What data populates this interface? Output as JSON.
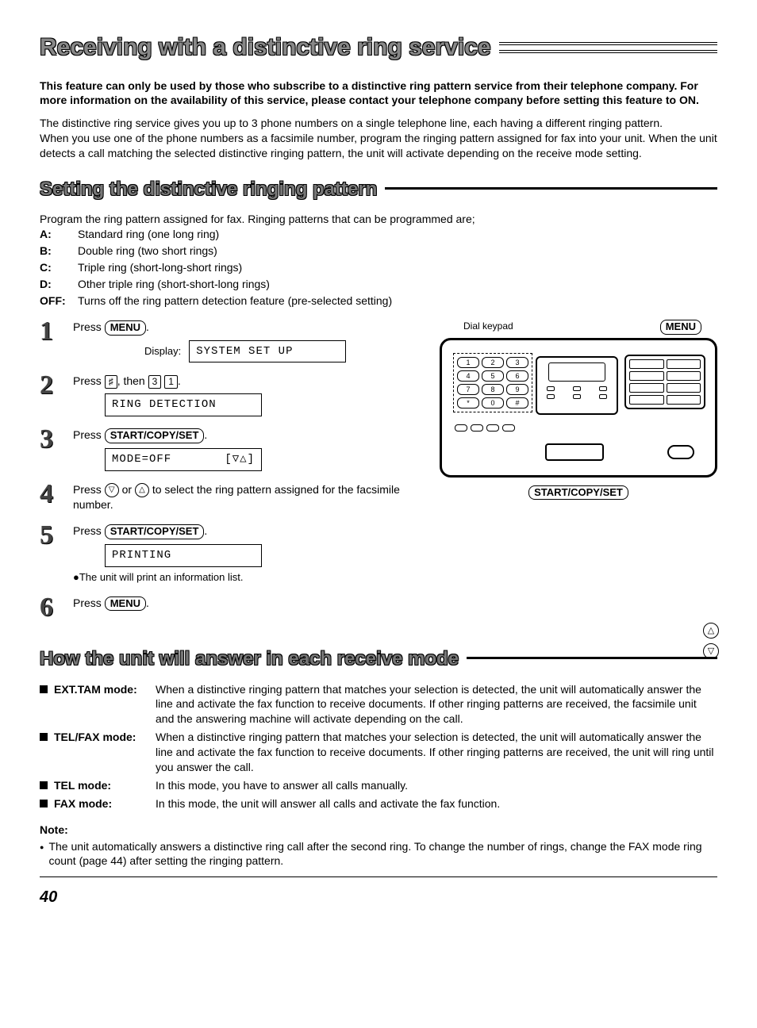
{
  "title": "Receiving with a distinctive ring service",
  "intro_bold": "This feature can only be used by those who subscribe to a distinctive ring pattern service from their telephone company. For more information on the availability of this service, please contact your telephone company before setting this feature to ON.",
  "intro_reg": "The distinctive ring service gives you up to 3 phone numbers on a single telephone line, each having a different ringing pattern.\nWhen you use one of the phone numbers as a facsimile number, program the ringing pattern assigned for fax into your unit. When the unit detects a call matching the selected distinctive ringing pattern, the unit will activate depending on the receive mode setting.",
  "section1": "Setting the distinctive ringing pattern",
  "patterns_intro": "Program the ring pattern assigned for fax. Ringing patterns that can be programmed are;",
  "patterns": [
    {
      "k": "A:",
      "v": "Standard ring (one long ring)"
    },
    {
      "k": "B:",
      "v": "Double ring (two short rings)"
    },
    {
      "k": "C:",
      "v": "Triple ring (short-long-short rings)"
    },
    {
      "k": "D:",
      "v": "Other triple ring (short-short-long rings)"
    },
    {
      "k": "OFF:",
      "v": "Turns off the ring pattern detection feature (pre-selected setting)"
    }
  ],
  "steps": {
    "s1_pre": "Press ",
    "s1_btn": "MENU",
    "s1_post": ".",
    "disp_label": "Display:",
    "lcd1": "SYSTEM SET UP",
    "s2_pre": "Press ",
    "s2_k1": "♯",
    "s2_mid": ", then ",
    "s2_k2": "3",
    "s2_k3": "1",
    "s2_post": ".",
    "lcd2": "RING DETECTION",
    "s3_pre": "Press ",
    "s3_btn": "START/COPY/SET",
    "s3_post": ".",
    "lcd3a": "MODE=OFF",
    "lcd3b": "[▽△]",
    "s4_pre": "Press ",
    "s4_mid": " or ",
    "s4_post": " to select the ring pattern assigned for the facsimile number.",
    "s4_t1": "▽",
    "s4_t2": "△",
    "s5_pre": "Press ",
    "s5_btn": "START/COPY/SET",
    "s5_post": ".",
    "lcd5": "PRINTING",
    "s5_note": "●The unit will print an information list.",
    "s6_pre": "Press ",
    "s6_btn": "MENU",
    "s6_post": "."
  },
  "diagram": {
    "dial_label": "Dial keypad",
    "menu_btn": "MENU",
    "scset": "START/COPY/SET",
    "up": "△",
    "down": "▽"
  },
  "section2": "How the unit will answer in each receive mode",
  "modes": [
    {
      "lbl": "EXT.TAM mode:",
      "txt": "When a distinctive ringing pattern that matches your selection is detected, the unit will automatically answer the line and activate the fax function to receive documents. If other ringing patterns are received, the facsimile unit and the answering machine will activate depending on the call."
    },
    {
      "lbl": "TEL/FAX mode:",
      "txt": "When a distinctive ringing pattern that matches your selection is detected, the unit will automatically answer the line and activate the fax function to receive documents. If other ringing patterns are received, the unit will ring until you answer the call."
    },
    {
      "lbl": "TEL mode:",
      "txt": "In this mode, you have to answer all calls manually."
    },
    {
      "lbl": "FAX mode:",
      "txt": "In this mode, the unit will answer all calls and activate the fax function."
    }
  ],
  "note_hdr": "Note:",
  "note_body": "The unit automatically answers a distinctive ring call after the second ring. To change the number of rings, change the FAX mode ring count (page 44) after setting the ringing pattern.",
  "page": "40"
}
